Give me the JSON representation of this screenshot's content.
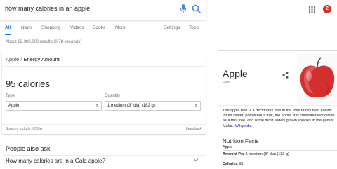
{
  "search": {
    "query": "how many calories in an apple"
  },
  "header": {
    "notification_count": "2"
  },
  "tabs": [
    {
      "label": "All"
    },
    {
      "label": "News"
    },
    {
      "label": "Shopping"
    },
    {
      "label": "Videos"
    },
    {
      "label": "Books"
    },
    {
      "label": "More"
    },
    {
      "label": "Settings"
    },
    {
      "label": "Tools"
    }
  ],
  "result_stats": "About 62,300,000 results (0.78 seconds)",
  "nutrition_card": {
    "breadcrumb_item": "Apple",
    "breadcrumb_sep": "/",
    "breadcrumb_current": "Energy Amount",
    "calories": "95 calories",
    "type_label": "Type",
    "type_value": "Apple",
    "quantity_label": "Quantity",
    "quantity_value": "1 medium (3\" dia) (182 g)",
    "sources": "Sources include: USDA",
    "feedback": "Feedback"
  },
  "people_also_ask": {
    "title": "People also ask",
    "question": "How many calories are in a Gala apple?"
  },
  "knowledge_panel": {
    "title": "Apple",
    "subtitle": "Fruit",
    "description": "The apple tree is a deciduous tree in the rose family best known for its sweet, pomaceous fruit, the apple. It is cultivated worldwide as a fruit tree, and is the most widely grown species in the genus Malus.",
    "description_link": "Wikipedia",
    "nutrition_title": "Nutrition Facts",
    "nutrition_subtitle": "Apple",
    "amount_per_label": "Amount Per",
    "amount_per_value": "1 medium (3\" dia) (182 g)",
    "calories_label": "Calories",
    "calories_value": "95"
  },
  "colors": {
    "accent": "#1a73e8",
    "badge": "#d93025",
    "link": "#1a0dab"
  },
  "icons": [
    "mic-icon",
    "search-icon",
    "apps-icon",
    "share-icon",
    "chevron-down-icon",
    "select-arrow-icon"
  ]
}
